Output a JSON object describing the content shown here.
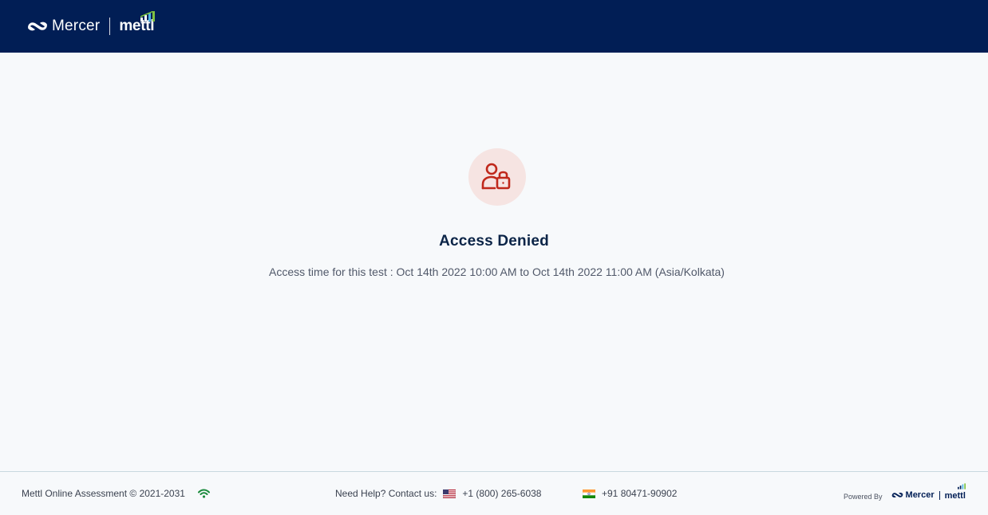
{
  "header": {
    "brand": "Mercer",
    "product": "mettl"
  },
  "status": {
    "icon": "user-lock-icon",
    "title": "Access Denied",
    "message": "Access time for this test : Oct 14th 2022 10:00 AM to Oct 14th 2022 11:00 AM (Asia/Kolkata)"
  },
  "footer": {
    "copyright": "Mettl Online Assessment © 2021-2031",
    "connection_icon": "wifi-icon",
    "help_label": "Need Help? Contact us:",
    "us_flag_icon": "us-flag-icon",
    "us_phone": "+1 (800) 265-6038",
    "in_flag_icon": "india-flag-icon",
    "in_phone": "+91 80471-90902",
    "powered_by": "Powered By",
    "powered_brand": "Mercer",
    "powered_product": "mettl"
  },
  "colors": {
    "header_bg": "#011e55",
    "accent_red": "#c0281b",
    "icon_bg": "#f6e4e2",
    "wifi_green": "#1a8a3c"
  }
}
